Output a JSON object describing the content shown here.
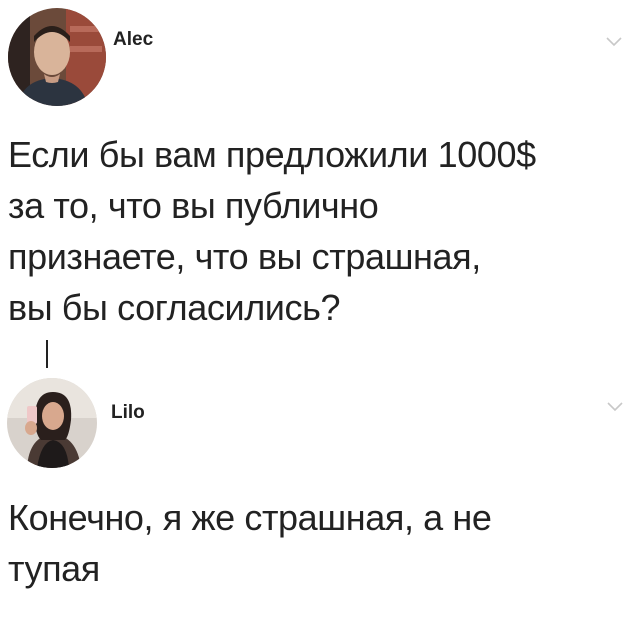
{
  "thread": {
    "tweets": [
      {
        "username": "Alec",
        "text": "Если бы вам предложили 1000$\nза то, что вы публично\nпризнаете, что вы страшная,\nвы бы согласились?",
        "menu_icon": "chevron-down-icon"
      },
      {
        "username": "Lilo",
        "text": "Конечно, я же страшная, а не\nтупая",
        "menu_icon": "chevron-down-icon"
      }
    ]
  },
  "colors": {
    "text": "#222222",
    "chevron": "#c8c8c8",
    "background": "#ffffff"
  }
}
